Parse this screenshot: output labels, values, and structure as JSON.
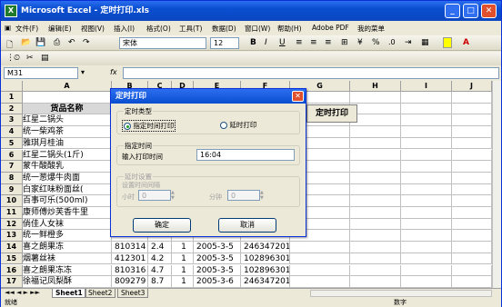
{
  "window": {
    "title": "Microsoft Excel - 定时打印.xls"
  },
  "menu": [
    "文件(F)",
    "编辑(E)",
    "视图(V)",
    "插入(I)",
    "格式(O)",
    "工具(T)",
    "数据(D)",
    "窗口(W)",
    "帮助(H)",
    "Adobe PDF",
    "我的菜单"
  ],
  "toolbar": {
    "font": "宋体",
    "size": "12",
    "bold": "B",
    "italic": "I",
    "underline": "U",
    "percent": "%"
  },
  "namebox": "M31",
  "fx": "fx",
  "columns": [
    "A",
    "B",
    "C",
    "D",
    "E",
    "F",
    "G",
    "H",
    "I",
    "J"
  ],
  "rows": [
    "1",
    "2",
    "3",
    "4",
    "5",
    "6",
    "7",
    "8",
    "9",
    "10",
    "11",
    "12",
    "13",
    "14",
    "15",
    "16",
    "17"
  ],
  "a_col": [
    "",
    "货品名称",
    "红星二锅头",
    "统一柴鸡茶",
    "雅琪月桂油",
    "红星二锅头(1斤)",
    "蒙牛酸酸乳",
    "统一葱爆牛肉面",
    "白家红味粉面丝(",
    "百事可乐(500ml)",
    "康师傅炒芙香牛里",
    "倘佳人女袜",
    "统一鲜橙多",
    "喜之朗果冻",
    "烟薯丝袜",
    "喜之朗果冻冻",
    "徐福记凤梨酥"
  ],
  "g2_button": "定时打印",
  "data_rows": [
    {
      "b": "810314",
      "c": "2.4",
      "d": "1",
      "e": "2005-3-5",
      "f": "246347201"
    },
    {
      "b": "412301",
      "c": "4.2",
      "d": "1",
      "e": "2005-3-5",
      "f": "102896301"
    },
    {
      "b": "810316",
      "c": "4.7",
      "d": "1",
      "e": "2005-3-5",
      "f": "102896301"
    },
    {
      "b": "809279",
      "c": "8.7",
      "d": "1",
      "e": "2005-3-6",
      "f": "246347201"
    }
  ],
  "sheets": [
    "Sheet1",
    "Sheet2",
    "Sheet3"
  ],
  "status": {
    "left": "就绪",
    "right": "数字"
  },
  "dialog": {
    "title": "定时打印",
    "group1": "定时类型",
    "radio1": "指定时间打印",
    "radio2": "延时打印",
    "group2": "指定时间",
    "time_label": "输入打印时间",
    "time_value": "16:04",
    "group3": "延时设置",
    "interval_label": "设置时间间隔",
    "hour_label": "小时",
    "hour_value": "0",
    "min_label": "分钟",
    "min_value": "0",
    "ok": "确定",
    "cancel": "取消"
  }
}
